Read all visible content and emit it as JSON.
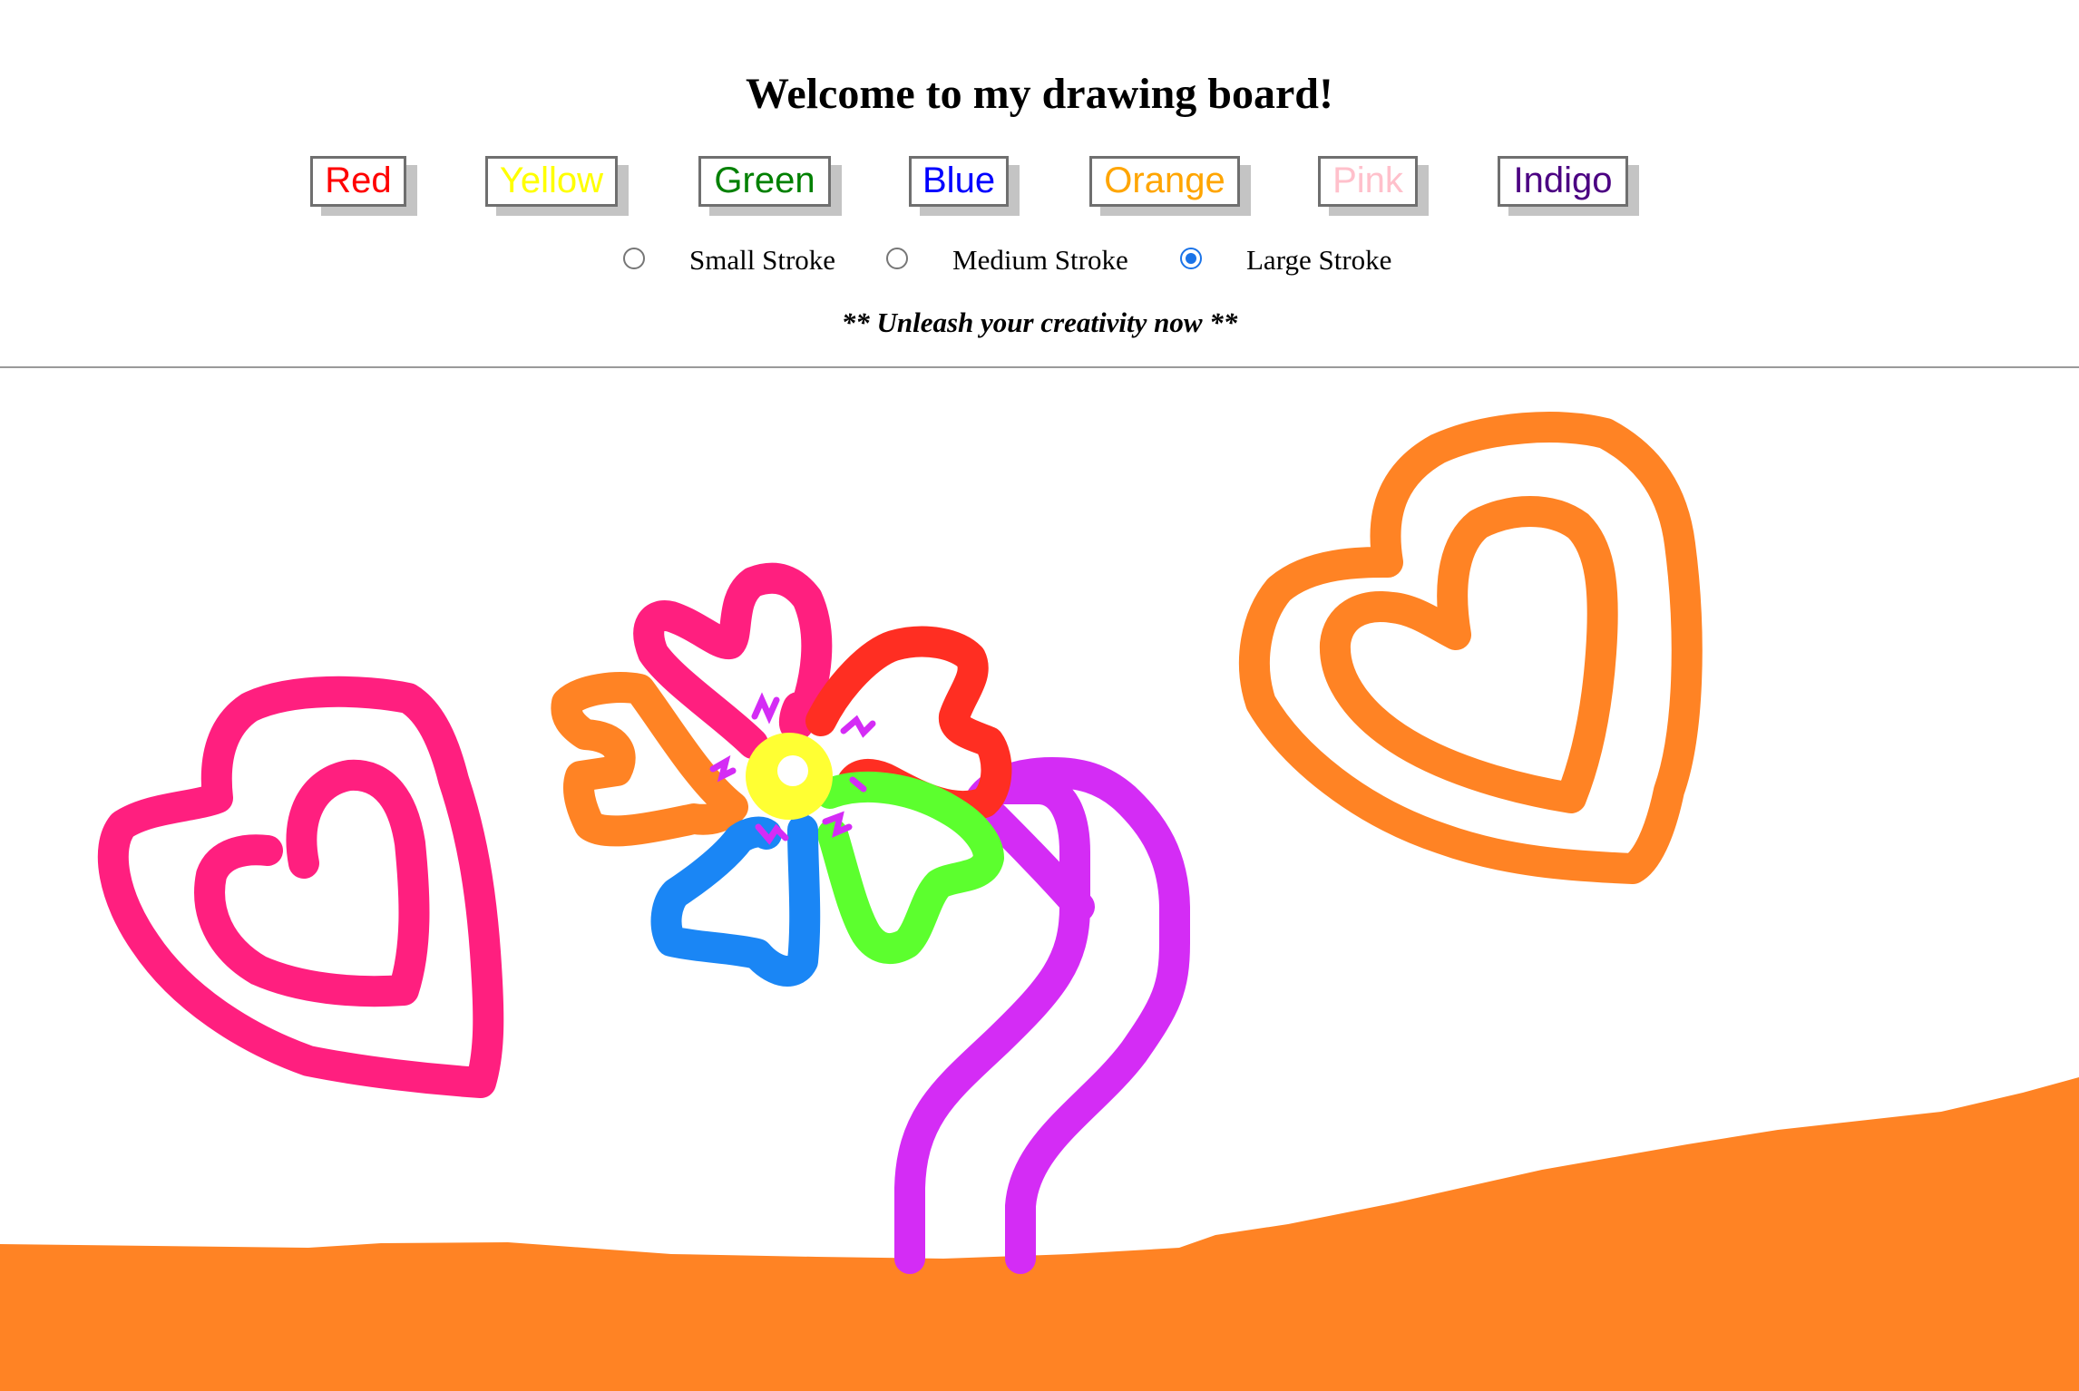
{
  "header": {
    "title": "Welcome to my drawing board!",
    "tagline": "** Unleash your creativity now **"
  },
  "color_buttons": [
    {
      "label": "Red",
      "color": "#ff0000"
    },
    {
      "label": "Yellow",
      "color": "#ffff00"
    },
    {
      "label": "Green",
      "color": "#008000"
    },
    {
      "label": "Blue",
      "color": "#0000ff"
    },
    {
      "label": "Orange",
      "color": "#ffa500"
    },
    {
      "label": "Pink",
      "color": "#ffc0cb"
    },
    {
      "label": "Indigo",
      "color": "#4b0082"
    }
  ],
  "stroke_options": [
    {
      "label": "Small Stroke",
      "checked": false
    },
    {
      "label": "Medium Stroke",
      "checked": false
    },
    {
      "label": "Large Stroke",
      "checked": true
    }
  ],
  "drawing_colors": {
    "pink": "#ff1f7f",
    "orange": "#ff8324",
    "red": "#ff2e22",
    "blue": "#1a86f5",
    "green": "#5cff2e",
    "yellow": "#ffff33",
    "purple": "#d42cf5"
  }
}
